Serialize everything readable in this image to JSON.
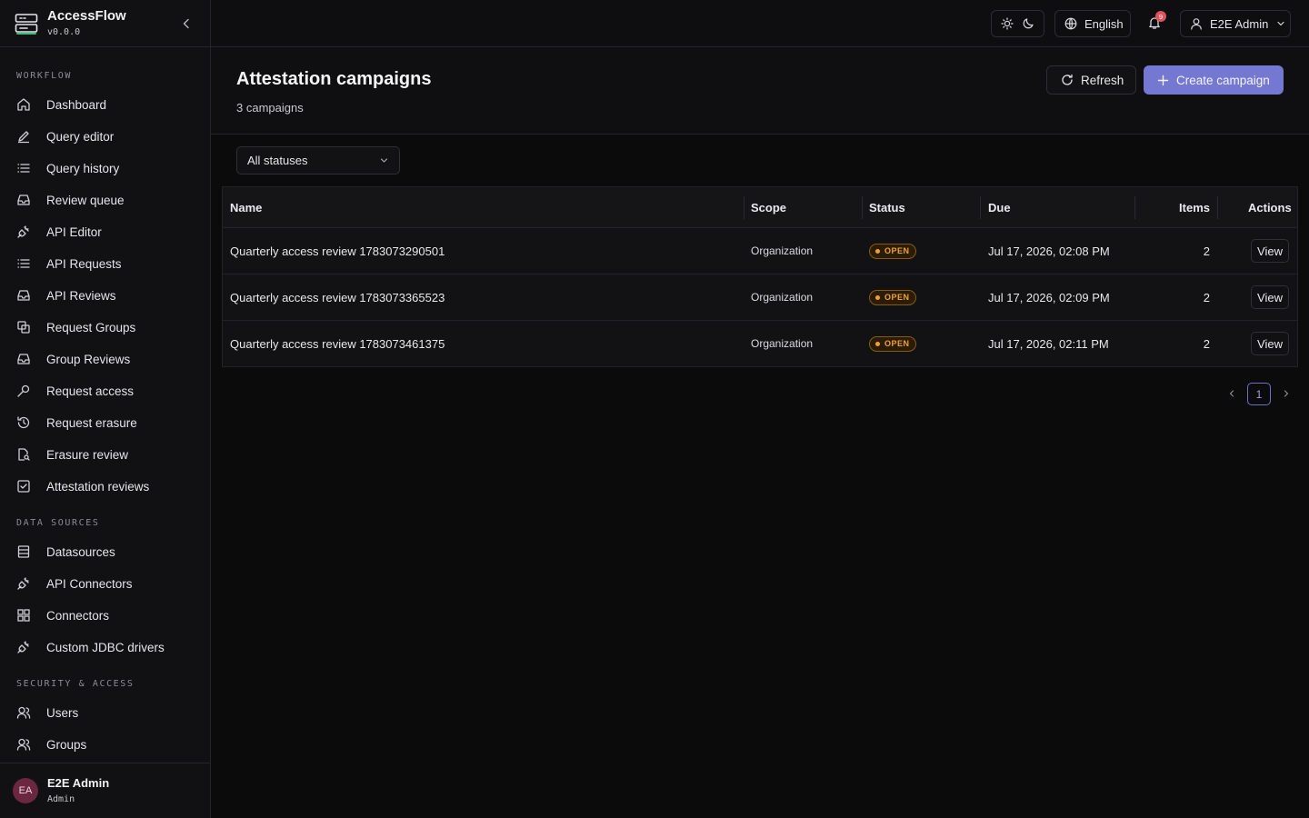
{
  "brand": {
    "name": "AccessFlow",
    "version": "v0.0.0"
  },
  "sidebar": {
    "sections": [
      {
        "title": "WORKFLOW",
        "items": [
          {
            "label": "Dashboard",
            "icon": "home-icon"
          },
          {
            "label": "Query editor",
            "icon": "pencil-icon"
          },
          {
            "label": "Query history",
            "icon": "list-icon"
          },
          {
            "label": "Review queue",
            "icon": "inbox-icon"
          },
          {
            "label": "API Editor",
            "icon": "plug-icon"
          },
          {
            "label": "API Requests",
            "icon": "list-icon"
          },
          {
            "label": "API Reviews",
            "icon": "inbox-icon"
          },
          {
            "label": "Request Groups",
            "icon": "layers-icon"
          },
          {
            "label": "Group Reviews",
            "icon": "inbox-icon"
          },
          {
            "label": "Request access",
            "icon": "key-icon"
          },
          {
            "label": "Request erasure",
            "icon": "history-icon"
          },
          {
            "label": "Erasure review",
            "icon": "file-search-icon"
          },
          {
            "label": "Attestation reviews",
            "icon": "check-square-icon"
          }
        ]
      },
      {
        "title": "DATA SOURCES",
        "items": [
          {
            "label": "Datasources",
            "icon": "database-icon"
          },
          {
            "label": "API Connectors",
            "icon": "plug-icon"
          },
          {
            "label": "Connectors",
            "icon": "grid-icon"
          },
          {
            "label": "Custom JDBC drivers",
            "icon": "plug-icon"
          }
        ]
      },
      {
        "title": "SECURITY & ACCESS",
        "items": [
          {
            "label": "Users",
            "icon": "users-icon"
          },
          {
            "label": "Groups",
            "icon": "users-icon"
          }
        ]
      }
    ]
  },
  "footer_user": {
    "initials": "EA",
    "name": "E2E Admin",
    "role": "Admin"
  },
  "header": {
    "language": "English",
    "notifications_count": "9",
    "user_label": "E2E Admin"
  },
  "page": {
    "title": "Attestation campaigns",
    "subtitle": "3 campaigns",
    "refresh_label": "Refresh",
    "create_label": "Create campaign",
    "status_filter": "All statuses"
  },
  "table": {
    "columns": [
      "Name",
      "Scope",
      "Status",
      "Due",
      "Items",
      "Actions"
    ],
    "rows": [
      {
        "name": "Quarterly access review 1783073290501",
        "scope": "Organization",
        "status": "OPEN",
        "due": "Jul 17, 2026, 02:08 PM",
        "items": "2",
        "action": "View"
      },
      {
        "name": "Quarterly access review 1783073365523",
        "scope": "Organization",
        "status": "OPEN",
        "due": "Jul 17, 2026, 02:09 PM",
        "items": "2",
        "action": "View"
      },
      {
        "name": "Quarterly access review 1783073461375",
        "scope": "Organization",
        "status": "OPEN",
        "due": "Jul 17, 2026, 02:11 PM",
        "items": "2",
        "action": "View"
      }
    ]
  },
  "pagination": {
    "current_page": "1"
  },
  "colors": {
    "accent": "#7478d0",
    "status_open": "#f0a22f",
    "background": "#0b0b0c"
  }
}
